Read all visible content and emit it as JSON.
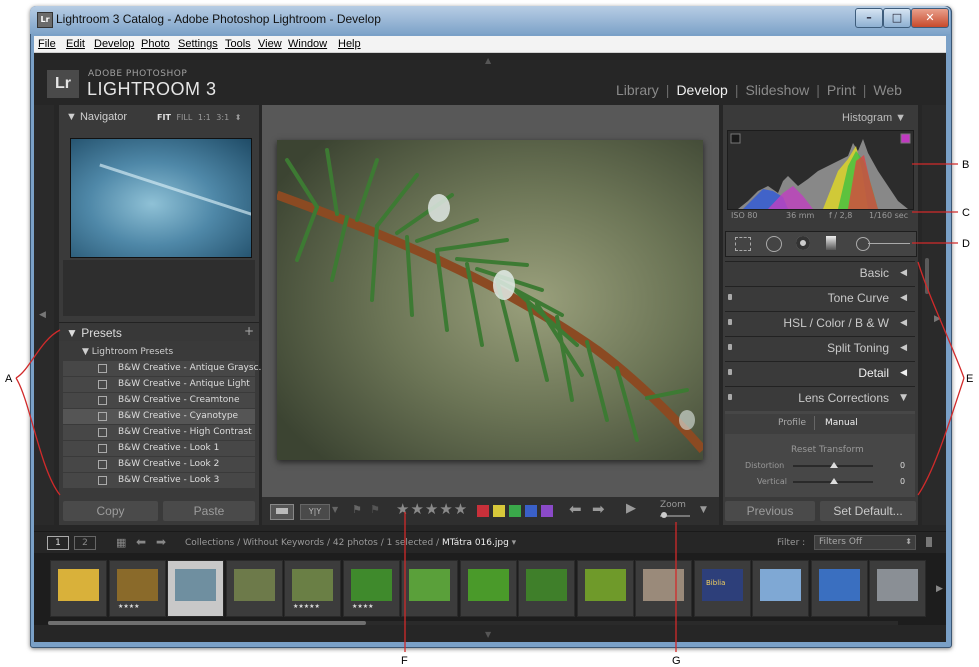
{
  "window": {
    "title": "Lightroom 3 Catalog - Adobe Photoshop Lightroom - Develop",
    "app_icon": "Lr",
    "minimize": "–",
    "maximize": "□",
    "close": "✕"
  },
  "menu": [
    "File",
    "Edit",
    "Develop",
    "Photo",
    "Settings",
    "Tools",
    "View",
    "Window",
    "Help"
  ],
  "brand": {
    "logo": "Lr",
    "line1": "ADOBE PHOTOSHOP",
    "line2": "LIGHTROOM 3"
  },
  "modules": {
    "library": "Library",
    "develop": "Develop",
    "slideshow": "Slideshow",
    "print": "Print",
    "web": "Web",
    "separator": "|"
  },
  "navigator": {
    "title": "▼  Navigator",
    "zoom": [
      "FIT",
      "FILL",
      "1:1",
      "3:1 ⬍"
    ]
  },
  "presets": {
    "title": "▼  Presets",
    "add": "+",
    "group": "▼  Lightroom Presets",
    "items": [
      "B&W Creative - Antique Graysc...",
      "B&W Creative - Antique Light",
      "B&W Creative - Creamtone",
      "B&W Creative - Cyanotype",
      "B&W Creative - High Contrast",
      "B&W Creative - Look 1",
      "B&W Creative - Look 2",
      "B&W Creative - Look 3"
    ]
  },
  "left_buttons": {
    "copy": "Copy",
    "paste": "Paste"
  },
  "histogram": {
    "title": "Histogram  ▼",
    "exif": {
      "iso": "ISO 80",
      "focal": "36 mm",
      "aperture": "f / 2,8",
      "shutter": "1/160 sec"
    }
  },
  "panels": [
    {
      "label": "Basic",
      "arrow": "◀",
      "switch": false,
      "bright": false
    },
    {
      "label": "Tone Curve",
      "arrow": "◀",
      "switch": true,
      "bright": false
    },
    {
      "label": "HSL  /  Color  /  B & W",
      "arrow": "◀",
      "switch": true,
      "bright": false
    },
    {
      "label": "Split Toning",
      "arrow": "◀",
      "switch": true,
      "bright": false
    },
    {
      "label": "Detail",
      "arrow": "◀",
      "switch": true,
      "bright": true
    },
    {
      "label": "Lens Corrections",
      "arrow": "▼",
      "switch": true,
      "bright": false
    }
  ],
  "lens": {
    "tab_profile": "Profile",
    "tab_manual": "Manual",
    "reset_transform": "Reset Transform",
    "distortion_label": "Distortion",
    "distortion_value": "0",
    "vertical_label": "Vertical",
    "vertical_value": "0"
  },
  "right_buttons": {
    "previous": "Previous",
    "set_default": "Set Default..."
  },
  "toolbar": {
    "stars": "★★★★★",
    "zoom_label": "Zoom",
    "yy": "Y|Y"
  },
  "filmstrip_bar": {
    "page1": "1",
    "page2": "2",
    "breadcrumb": "Collections / Without Keywords / 42 photos / 1 selected /",
    "filename": "MTátra 016.jpg",
    "filter_label": "Filter :",
    "filter_value": "Filters Off"
  },
  "thumbnails": [
    {
      "stars": "",
      "color": "#d9b13a"
    },
    {
      "stars": "★★★★",
      "color": "#8a6a2a"
    },
    {
      "stars": "",
      "color": "#6f8fa0",
      "selected": true
    },
    {
      "stars": "",
      "color": "#6d7a4a"
    },
    {
      "stars": "★★★★★",
      "color": "#6a7f45"
    },
    {
      "stars": "★★★★",
      "color": "#3f8a2c"
    },
    {
      "stars": "",
      "color": "#5aa03a"
    },
    {
      "stars": "",
      "color": "#4a9a2a"
    },
    {
      "stars": "",
      "color": "#3f7f2a"
    },
    {
      "stars": "",
      "color": "#6f9a2a"
    },
    {
      "stars": "",
      "color": "#9a8a7a"
    },
    {
      "stars": "",
      "color": "#2d3f7a",
      "text": "Biblia"
    },
    {
      "stars": "",
      "color": "#7fa8d4"
    },
    {
      "stars": "",
      "color": "#3a6fc0"
    },
    {
      "stars": "",
      "color": "#8a8f95"
    }
  ],
  "callouts": {
    "A": "A",
    "B": "B",
    "C": "C",
    "D": "D",
    "E": "E",
    "F": "F",
    "G": "G"
  },
  "colors": {
    "background": "#262626",
    "panel": "#3a3a3a",
    "selected_thumb": "#c8c8c8"
  }
}
